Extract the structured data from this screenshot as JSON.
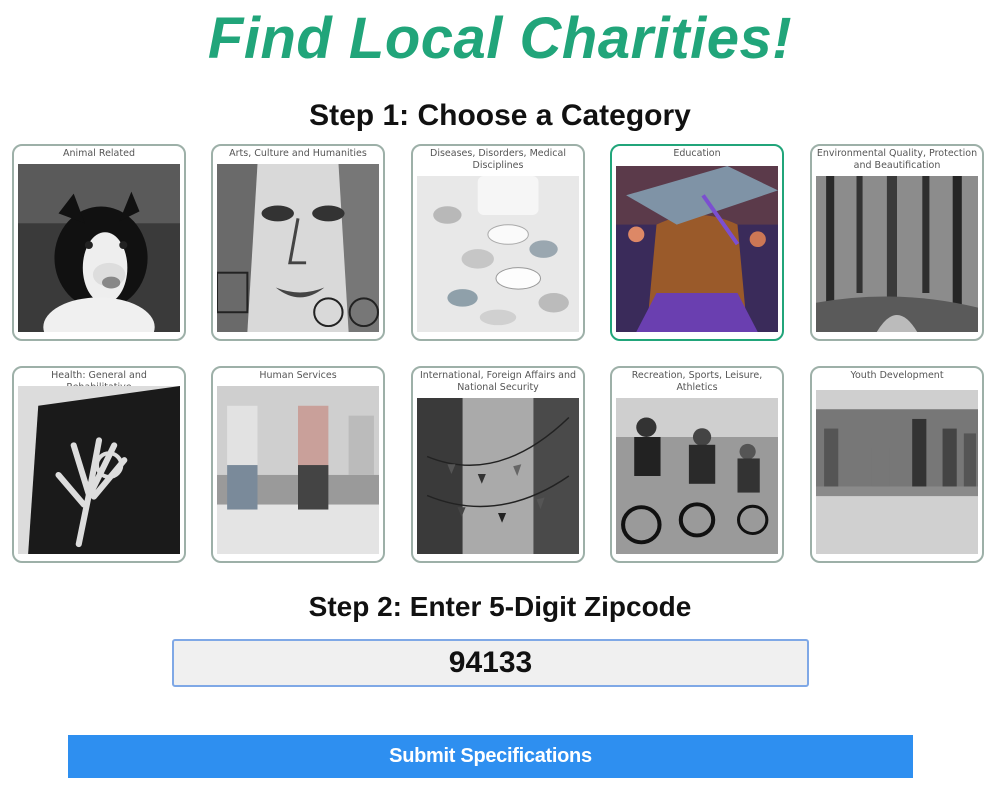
{
  "header": {
    "title": "Find Local Charities!"
  },
  "step1": {
    "heading": "Step 1: Choose a Category"
  },
  "categories": [
    {
      "label": "Animal Related",
      "image": "border-collie-dog-photo"
    },
    {
      "label": "Arts, Culture and Humanities",
      "image": "mural-face-photo"
    },
    {
      "label": "Diseases, Disorders, Medical Disciplines",
      "image": "pills-photo"
    },
    {
      "label": "Education",
      "image": "graduation-cap-photo",
      "selected": true
    },
    {
      "label": "Environmental Quality, Protection and Beautification",
      "image": "forest-path-photo"
    },
    {
      "label": "Health: General and Rehabilitative",
      "image": "hand-xray-photo"
    },
    {
      "label": "Human Services",
      "image": "people-sitting-photo"
    },
    {
      "label": "International, Foreign Affairs and National Security",
      "image": "flags-street-photo"
    },
    {
      "label": "Recreation, Sports, Leisure, Athletics",
      "image": "cyclists-photo"
    },
    {
      "label": "Youth Development",
      "image": "youth-group-photo"
    }
  ],
  "step2": {
    "heading": "Step 2: Enter 5-Digit Zipcode",
    "zipcode": "94133"
  },
  "submit": {
    "label": "Submit Specifications"
  },
  "colors": {
    "title": "#21a57a",
    "selected_border": "#21a57a",
    "card_border": "#9db0a8",
    "submit_bg": "#2e8ff0"
  }
}
